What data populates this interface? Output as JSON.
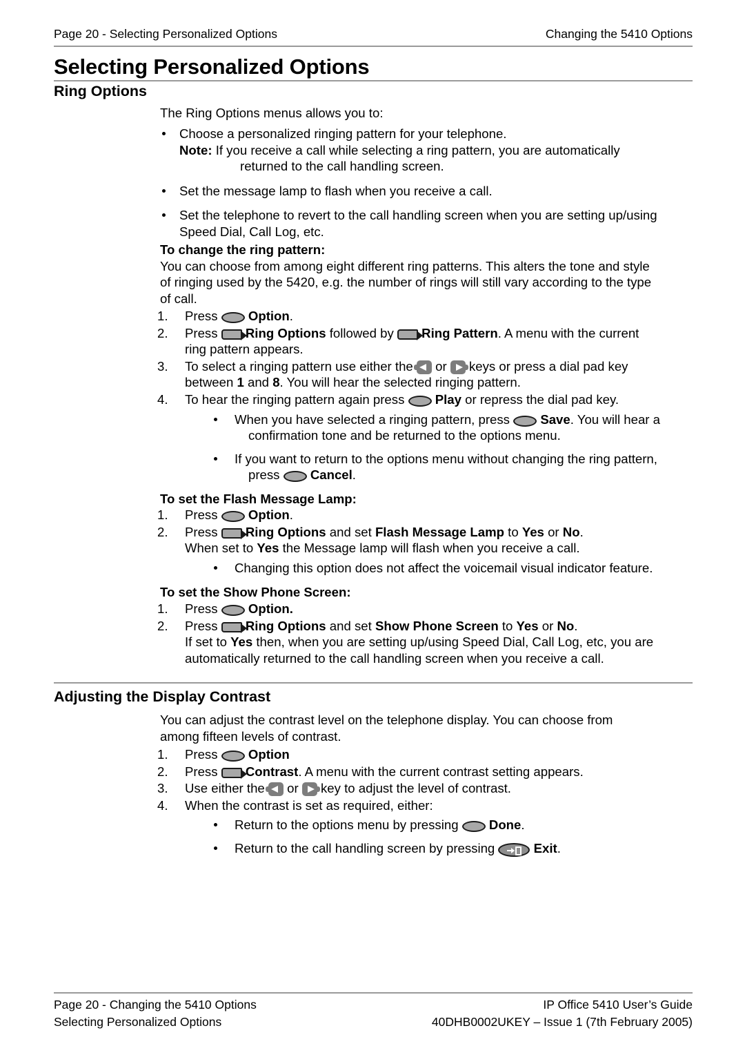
{
  "header": {
    "left": "Page 20 - Selecting Personalized Options",
    "right": "Changing the 5410 Options"
  },
  "title": "Selecting Personalized Options",
  "sections": {
    "ring_options": {
      "heading": "Ring Options",
      "intro": "The Ring Options menus allows you to:",
      "bullets": {
        "b1": "Choose a personalized ringing pattern for your telephone.",
        "note_label": "Note:",
        "note_text": "If you receive a call while selecting a ring pattern, you are automatically",
        "note_text_cont": "returned to the call handling screen.",
        "b2": "Set the message lamp to flash when you receive a call.",
        "b3": "Set the telephone to revert to the call handling screen when you are setting up/using",
        "b3_cont": "Speed Dial, Call Log, etc."
      },
      "ring_pattern": {
        "subhead": "To change the ring pattern:",
        "intro_1": "You can choose from among eight different ring patterns. This alters the tone and style",
        "intro_2": "of ringing used by the 5420, e.g. the number of rings will still vary according to the type",
        "intro_3": "of call.",
        "step1_num": "1.",
        "step1_a": "Press",
        "step1_b": "Option",
        "step1_c": ".",
        "step2_num": "2.",
        "step2_a": "Press",
        "step2_b": "Ring Options",
        "step2_c": "followed by",
        "step2_d": "Ring Pattern",
        "step2_e": ". A menu with the current",
        "step2_f": "ring pattern appears.",
        "step3_num": "3.",
        "step3_a": "To select a ringing pattern use either the",
        "step3_b": "or",
        "step3_c": "keys or press a dial pad key",
        "step3_d": "between",
        "step3_e": "1",
        "step3_f": "and",
        "step3_g": "8",
        "step3_h": ". You will hear the selected ringing pattern.",
        "step4_num": "4.",
        "step4_a": "To hear the ringing pattern again press",
        "step4_b": "Play",
        "step4_c": "or repress the dial pad key.",
        "sub1_a": "When you have selected a ringing pattern, press",
        "sub1_b": "Save",
        "sub1_c": ". You will hear a",
        "sub1_cont": "confirmation tone and be returned to the options menu.",
        "sub2_a": "If you want to return to the options menu without changing the ring pattern,",
        "sub2_b": "press",
        "sub2_c": "Cancel",
        "sub2_d": "."
      },
      "flash_lamp": {
        "subhead": "To set the Flash Message Lamp:",
        "step1_num": "1.",
        "step1_a": "Press",
        "step1_b": "Option",
        "step1_c": ".",
        "step2_num": "2.",
        "step2_a": "Press",
        "step2_b": "Ring Options",
        "step2_c": "and set",
        "step2_d": "Flash Message Lamp",
        "step2_e": "to",
        "step2_f": "Yes",
        "step2_g": "or",
        "step2_h": "No",
        "step2_i": ".",
        "step2_cont_a": "When set to",
        "step2_cont_b": "Yes",
        "step2_cont_c": "the Message lamp will flash when you receive a call.",
        "sub1": "Changing this option does not affect the voicemail visual indicator feature."
      },
      "show_screen": {
        "subhead": "To set the Show Phone Screen:",
        "step1_num": "1.",
        "step1_a": "Press",
        "step1_b": "Option.",
        "step2_num": "2.",
        "step2_a": "Press",
        "step2_b": "Ring Options",
        "step2_c": "and set",
        "step2_d": "Show Phone Screen",
        "step2_e": "to",
        "step2_f": "Yes",
        "step2_g": "or",
        "step2_h": "No",
        "step2_i": ".",
        "step2_cont_a": "If set to",
        "step2_cont_b": "Yes",
        "step2_cont_c": "then, when you are setting up/using Speed Dial, Call Log, etc, you are",
        "step2_cont_d": "automatically returned to the call handling screen when you receive a call."
      }
    },
    "contrast": {
      "heading": "Adjusting the Display Contrast",
      "intro_1": "You can adjust the contrast level on the telephone display. You can choose from",
      "intro_2": "among fifteen levels of contrast.",
      "step1_num": "1.",
      "step1_a": "Press",
      "step1_b": "Option",
      "step2_num": "2.",
      "step2_a": "Press",
      "step2_b": "Contrast",
      "step2_c": ". A menu with the current contrast setting appears.",
      "step3_num": "3.",
      "step3_a": "Use either the",
      "step3_b": "or",
      "step3_c": "key to adjust the level of contrast.",
      "step4_num": "4.",
      "step4_a": "When the contrast is set as required, either:",
      "sub1_a": "Return to the options menu by pressing",
      "sub1_b": "Done",
      "sub1_c": ".",
      "sub2_a": "Return to the call handling screen by pressing",
      "sub2_b": "Exit",
      "sub2_c": "."
    }
  },
  "footer": {
    "left_line1": "Page 20 - Changing the 5410 Options",
    "left_line2": "Selecting Personalized Options",
    "right_line1": "IP Office 5410 User’s Guide",
    "right_line2": "40DHB0002UKEY – Issue 1 (7th February 2005)"
  },
  "icons": {
    "oval_softkey": "oval-softkey-icon",
    "display_softkey": "display-softkey-icon",
    "nav_left": "nav-left-key-icon",
    "nav_right": "nav-right-key-icon",
    "exit": "exit-key-icon"
  },
  "colors": {
    "rule": "#9a9a9a",
    "key_fill": "#a8a8a8",
    "navkey_fill": "#7d7d7d",
    "text": "#000000"
  }
}
